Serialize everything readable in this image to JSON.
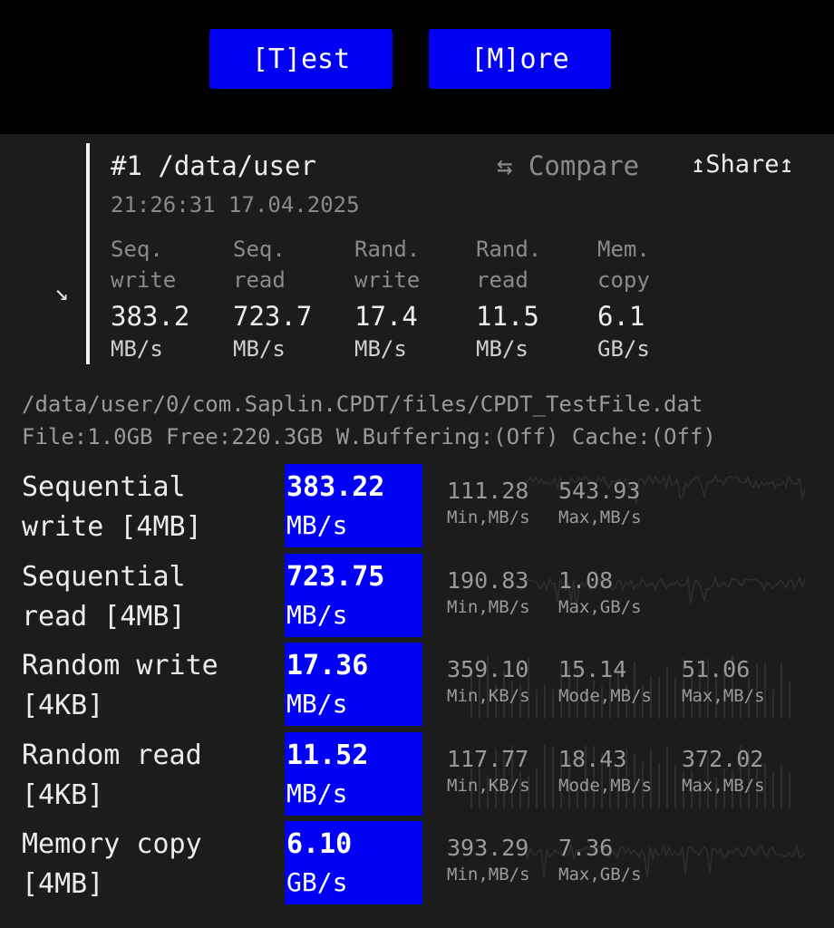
{
  "toolbar": {
    "test_label": "[T]est",
    "more_label": "[M]ore"
  },
  "result": {
    "title": "#1 /data/user",
    "timestamp": "21:26:31 17.04.2025",
    "compare_label": "⇆ Compare",
    "share_label": "↥Share↥",
    "collapse_icon": "arrow-down-right-icon",
    "summary": [
      {
        "label1": "Seq.",
        "label2": "write",
        "value": "383.2",
        "unit": "MB/s"
      },
      {
        "label1": "Seq.",
        "label2": "read",
        "value": "723.7",
        "unit": "MB/s"
      },
      {
        "label1": "Rand.",
        "label2": "write",
        "value": "17.4",
        "unit": "MB/s"
      },
      {
        "label1": "Rand.",
        "label2": "read",
        "value": "11.5",
        "unit": "MB/s"
      },
      {
        "label1": "Mem.",
        "label2": "copy",
        "value": "6.1",
        "unit": "GB/s"
      }
    ]
  },
  "file": {
    "path": "/data/user/0/com.Saplin.CPDT/files/CPDT_TestFile.dat",
    "info": "File:1.0GB Free:220.3GB W.Buffering:(Off) Cache:(Off)"
  },
  "tests": [
    {
      "name1": "Sequential",
      "name2": "write [4MB]",
      "value": "383.22",
      "unit": "MB/s",
      "stats": [
        {
          "value": "111.28",
          "label": "Min,MB/s"
        },
        {
          "value": "543.93",
          "label": "Max,MB/s"
        }
      ]
    },
    {
      "name1": "Sequential",
      "name2": "read [4MB]",
      "value": "723.75",
      "unit": "MB/s",
      "stats": [
        {
          "value": "190.83",
          "label": "Min,MB/s"
        },
        {
          "value": "1.08",
          "label": "Max,GB/s"
        }
      ]
    },
    {
      "name1": "Random write",
      "name2": "[4KB]",
      "value": "17.36",
      "unit": "MB/s",
      "stats": [
        {
          "value": "359.10",
          "label": "Min,KB/s"
        },
        {
          "value": "15.14",
          "label": "Mode,MB/s"
        },
        {
          "value": "51.06",
          "label": "Max,MB/s"
        }
      ]
    },
    {
      "name1": "Random read",
      "name2": "[4KB]",
      "value": "11.52",
      "unit": "MB/s",
      "stats": [
        {
          "value": "117.77",
          "label": "Min,KB/s"
        },
        {
          "value": "18.43",
          "label": "Mode,MB/s"
        },
        {
          "value": "372.02",
          "label": "Max,MB/s"
        }
      ]
    },
    {
      "name1": "Memory copy",
      "name2": "[4MB]",
      "value": "6.10",
      "unit": "GB/s",
      "stats": [
        {
          "value": "393.29",
          "label": "Min,MB/s"
        },
        {
          "value": "7.36",
          "label": "Max,GB/s"
        }
      ]
    }
  ],
  "colors": {
    "accent": "#0000f5",
    "panel_bg": "#1c1c1c",
    "muted_text": "#8a8a8a"
  }
}
